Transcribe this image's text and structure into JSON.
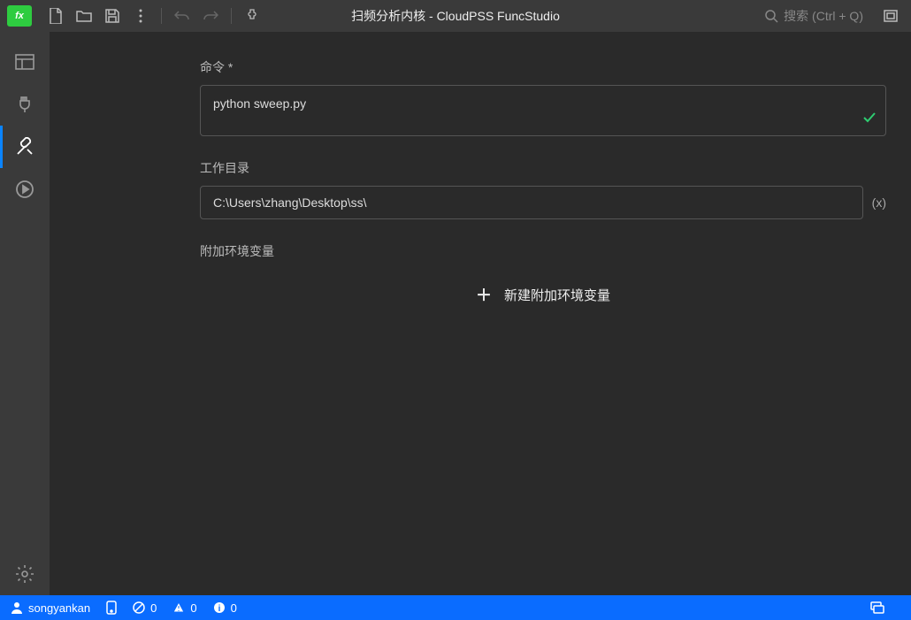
{
  "titlebar": {
    "title": "扫频分析内核 - CloudPSS FuncStudio",
    "search_placeholder": "搜索 (Ctrl + Q)"
  },
  "form": {
    "command_label": "命令 *",
    "command_value": "python sweep.py",
    "workdir_label": "工作目录",
    "workdir_value": "C:\\Users\\zhang\\Desktop\\ss\\",
    "workdir_suffix": "(x)",
    "env_label": "附加环境变量",
    "add_env_label": "新建附加环境变量"
  },
  "status": {
    "user": "songyankan",
    "errors": "0",
    "warnings": "0",
    "info": "0"
  }
}
